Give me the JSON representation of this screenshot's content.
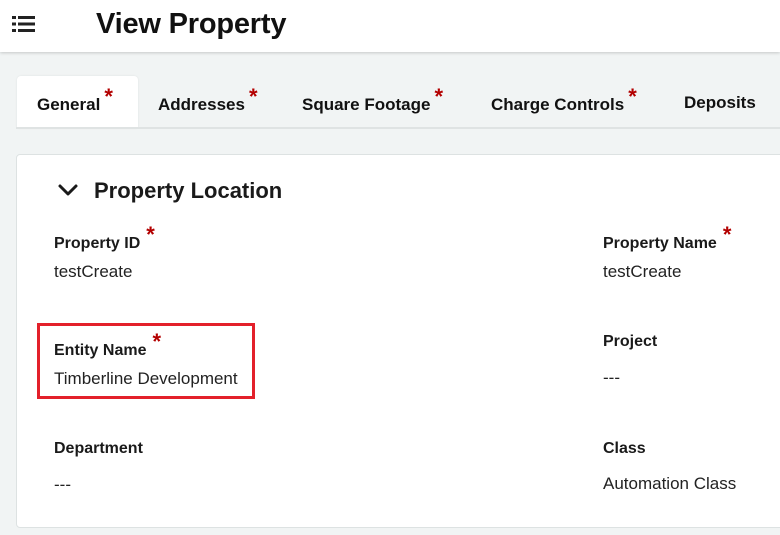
{
  "header": {
    "title": "View Property"
  },
  "tabs": [
    {
      "label": "General",
      "required": "*",
      "active": true
    },
    {
      "label": "Addresses",
      "required": "*"
    },
    {
      "label": "Square Footage",
      "required": "*"
    },
    {
      "label": "Charge Controls",
      "required": "*"
    },
    {
      "label": "Deposits"
    }
  ],
  "section": {
    "title": "Property Location"
  },
  "fields": {
    "property_id": {
      "label": "Property ID",
      "required": "*",
      "value": "testCreate"
    },
    "property_name": {
      "label": "Property Name",
      "required": "*",
      "value": "testCreate"
    },
    "entity_name": {
      "label": "Entity Name",
      "required": "*",
      "value": "Timberline Development"
    },
    "project": {
      "label": "Project",
      "value": "---"
    },
    "department": {
      "label": "Department",
      "value": "---"
    },
    "class": {
      "label": "Class",
      "value": "Automation Class"
    }
  },
  "colors": {
    "accent": "#0b6b4f",
    "required": "#b30000",
    "highlight": "#e3202a"
  },
  "icons": {
    "menu": "list-menu-icon",
    "toggle": "chevron-down-icon"
  }
}
